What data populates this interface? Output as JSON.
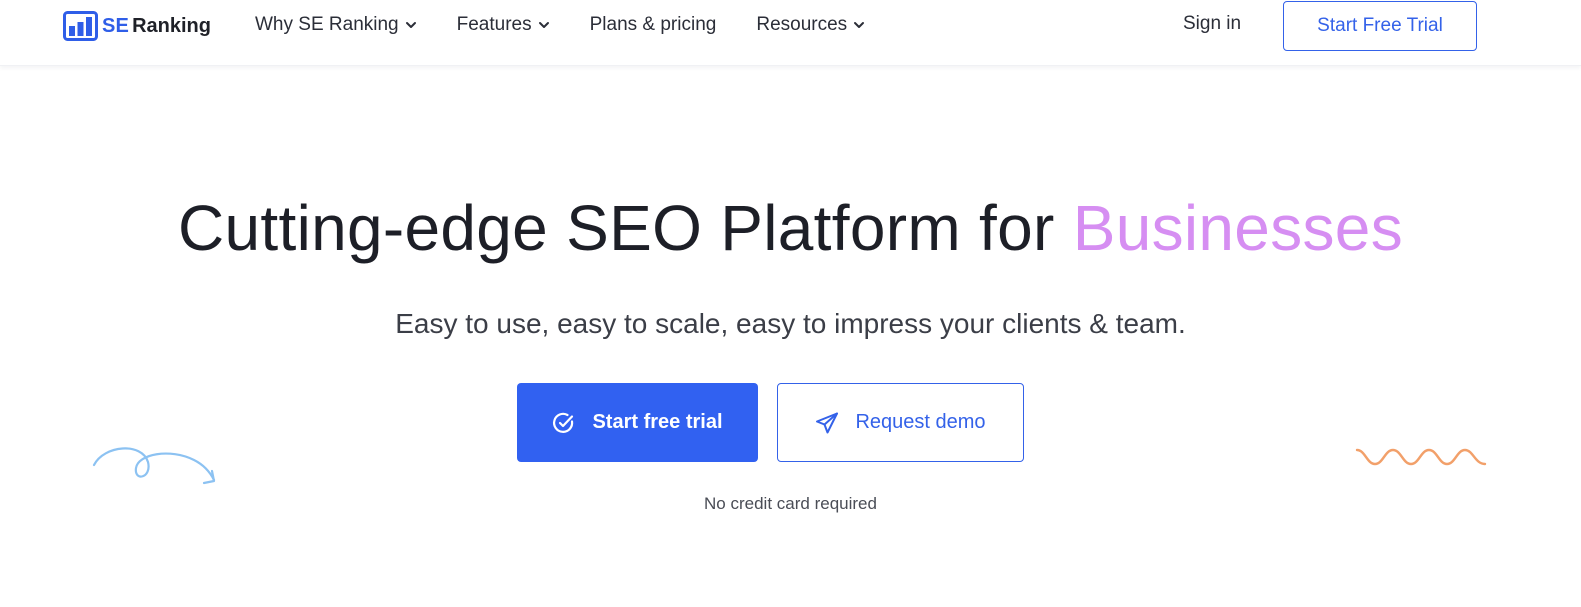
{
  "brand": {
    "logo_se": "SE",
    "logo_ranking": "Ranking",
    "primary_color": "#3161f1",
    "accent_color": "#d68ef2"
  },
  "nav": {
    "items": [
      {
        "label": "Why SE Ranking",
        "has_dropdown": true
      },
      {
        "label": "Features",
        "has_dropdown": true
      },
      {
        "label": "Plans & pricing",
        "has_dropdown": false
      },
      {
        "label": "Resources",
        "has_dropdown": true
      }
    ],
    "sign_in": "Sign in",
    "cta": "Start Free Trial"
  },
  "hero": {
    "title_main": "Cutting-edge SEO Platform for ",
    "title_accent": "Businesses",
    "subtitle": "Easy to use, easy to scale, easy to impress your clients & team.",
    "primary_button": "Start free trial",
    "secondary_button": "Request demo",
    "note": "No credit card required"
  },
  "icons": {
    "logo": "bar-chart-logo-icon",
    "dropdown": "chevron-down-icon",
    "primary_button": "check-circle-icon",
    "secondary_button": "paper-plane-icon"
  }
}
